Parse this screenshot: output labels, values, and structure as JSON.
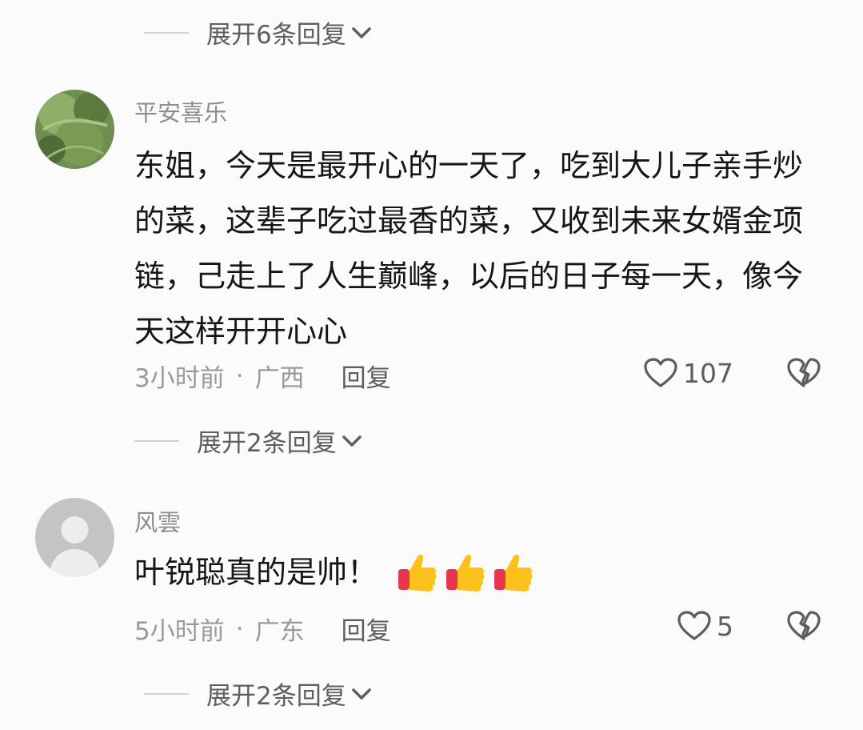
{
  "top_expand": {
    "label": "展开6条回复"
  },
  "comments": [
    {
      "username": "平安喜乐",
      "text": "东姐，今天是最开心的一天了，吃到大儿子亲手炒的菜，这辈子吃过最香的菜，又收到未来女婿金项链，己走上了人生巅峰，以后的日子每一天，像今天这样开开心心",
      "time": "3小时前",
      "separator": "·",
      "location": "广西",
      "reply_label": "回复",
      "likes": "107",
      "expand_label": "展开2条回复"
    },
    {
      "username": "风雲",
      "text": "叶锐聪真的是帅！",
      "time": "5小时前",
      "separator": "·",
      "location": "广东",
      "reply_label": "回复",
      "likes": "5",
      "expand_label": "展开2条回复",
      "emoji": "thumbs-up x3"
    }
  ],
  "colors": {
    "background": "#fbfbfb",
    "text": "#161616",
    "muted": "#9a9a9a",
    "username": "#8d8d8d"
  },
  "icons": [
    "chevron-down-icon",
    "heart-outline-icon",
    "broken-heart-icon",
    "thumbs-up-emoji"
  ]
}
